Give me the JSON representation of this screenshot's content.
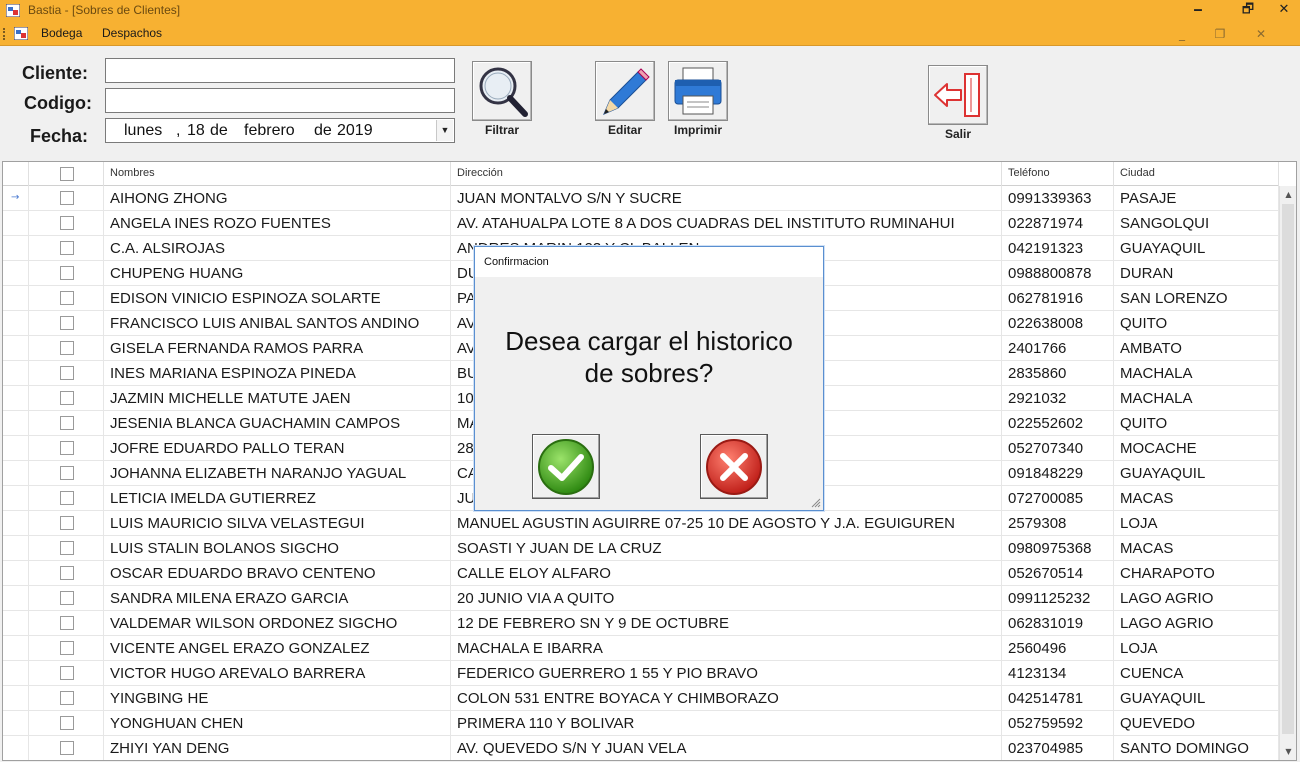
{
  "window": {
    "title": "Bastia - [Sobres de Clientes]",
    "controls": [
      "🗕",
      "🗗",
      "✕"
    ]
  },
  "menu": {
    "items": [
      "Bodega",
      "Despachos"
    ],
    "mdi_controls": [
      "_",
      "❐",
      "✕"
    ]
  },
  "form": {
    "cliente_label": "Cliente:",
    "codigo_label": "Codigo:",
    "fecha_label": "Fecha:",
    "cliente_value": "",
    "codigo_value": "",
    "fecha": {
      "weekday": "lunes",
      "sep1": ",",
      "day": "18",
      "de1": "de",
      "month": "febrero",
      "de2": "de",
      "year": "2019"
    }
  },
  "toolbar": {
    "filtrar_label": "Filtrar",
    "editar_label": "Editar",
    "imprimir_label": "Imprimir",
    "salir_label": "Salir"
  },
  "grid": {
    "columns": [
      "",
      "Nombres",
      "Dirección",
      "Teléfono",
      "Ciudad"
    ],
    "rows": [
      {
        "nombre": "AIHONG ZHONG",
        "direccion": "JUAN MONTALVO S/N Y SUCRE",
        "telefono": "0991339363",
        "ciudad": "PASAJE"
      },
      {
        "nombre": "ANGELA INES ROZO FUENTES",
        "direccion": "AV. ATAHUALPA LOTE 8 A DOS CUADRAS DEL INSTITUTO RUMINAHUI",
        "telefono": "022871974",
        "ciudad": "SANGOLQUI"
      },
      {
        "nombre": "C.A. ALSIROJAS",
        "direccion": "ANDRES MARIN 123 Y CL BALLEN",
        "telefono": "042191323",
        "ciudad": "GUAYAQUIL"
      },
      {
        "nombre": "CHUPENG HUANG",
        "direccion": "DU",
        "telefono": "0988800878",
        "ciudad": "DURAN"
      },
      {
        "nombre": "EDISON VINICIO ESPINOZA SOLARTE",
        "direccion": "PA",
        "telefono": "062781916",
        "ciudad": "SAN LORENZO"
      },
      {
        "nombre": "FRANCISCO LUIS ANIBAL SANTOS ANDINO",
        "direccion": "AV                                                   R OCCIDENTE",
        "telefono": "022638008",
        "ciudad": "QUITO"
      },
      {
        "nombre": "GISELA FERNANDA RAMOS PARRA",
        "direccion": "AV",
        "telefono": "2401766",
        "ciudad": "AMBATO"
      },
      {
        "nombre": "INES MARIANA ESPINOZA PINEDA",
        "direccion": "BU",
        "telefono": "2835860",
        "ciudad": "MACHALA"
      },
      {
        "nombre": "JAZMIN MICHELLE MATUTE JAEN",
        "direccion": "10",
        "telefono": "2921032",
        "ciudad": "MACHALA"
      },
      {
        "nombre": "JESENIA BLANCA GUACHAMIN CAMPOS",
        "direccion": "MA                                                 ONA",
        "telefono": "022552602",
        "ciudad": "QUITO"
      },
      {
        "nombre": "JOFRE EDUARDO PALLO TERAN",
        "direccion": "28                                                  A",
        "telefono": "052707340",
        "ciudad": "MOCACHE"
      },
      {
        "nombre": "JOHANNA ELIZABETH NARANJO YAGUAL",
        "direccion": "CA",
        "telefono": "091848229",
        "ciudad": "GUAYAQUIL"
      },
      {
        "nombre": "LETICIA IMELDA GUTIERREZ",
        "direccion": "JU",
        "telefono": "072700085",
        "ciudad": "MACAS"
      },
      {
        "nombre": "LUIS MAURICIO SILVA VELASTEGUI",
        "direccion": "MANUEL AGUSTIN AGUIRRE 07-25  10 DE AGOSTO Y J.A. EGUIGUREN",
        "telefono": "2579308",
        "ciudad": "LOJA"
      },
      {
        "nombre": "LUIS STALIN BOLANOS SIGCHO",
        "direccion": "SOASTI Y JUAN DE LA CRUZ",
        "telefono": "0980975368",
        "ciudad": "MACAS"
      },
      {
        "nombre": "OSCAR EDUARDO BRAVO CENTENO",
        "direccion": "CALLE ELOY ALFARO",
        "telefono": "052670514",
        "ciudad": "CHARAPOTO"
      },
      {
        "nombre": "SANDRA MILENA ERAZO GARCIA",
        "direccion": "20 JUNIO VIA A QUITO",
        "telefono": "0991125232",
        "ciudad": "LAGO AGRIO"
      },
      {
        "nombre": "VALDEMAR WILSON ORDONEZ SIGCHO",
        "direccion": "12 DE FEBRERO SN Y 9 DE OCTUBRE",
        "telefono": "062831019",
        "ciudad": "LAGO AGRIO"
      },
      {
        "nombre": "VICENTE ANGEL ERAZO GONZALEZ",
        "direccion": "MACHALA E IBARRA",
        "telefono": "2560496",
        "ciudad": "LOJA"
      },
      {
        "nombre": "VICTOR HUGO AREVALO BARRERA",
        "direccion": "FEDERICO GUERRERO 1 55 Y PIO BRAVO",
        "telefono": "4123134",
        "ciudad": "CUENCA"
      },
      {
        "nombre": "YINGBING HE",
        "direccion": "COLON 531 ENTRE BOYACA Y CHIMBORAZO",
        "telefono": "042514781",
        "ciudad": "GUAYAQUIL"
      },
      {
        "nombre": "YONGHUAN CHEN",
        "direccion": "PRIMERA 110 Y BOLIVAR",
        "telefono": "052759592",
        "ciudad": "QUEVEDO"
      },
      {
        "nombre": "ZHIYI YAN DENG",
        "direccion": "AV. QUEVEDO S/N Y JUAN VELA",
        "telefono": "023704985",
        "ciudad": "SANTO DOMINGO"
      }
    ]
  },
  "dialog": {
    "title": "Confirmacion",
    "message_line1": "Desea cargar el historico",
    "message_line2": "de sobres?"
  },
  "colors": {
    "titlebar": "#f7b132",
    "accept": "#4caf1e",
    "cancel": "#d9302a"
  }
}
